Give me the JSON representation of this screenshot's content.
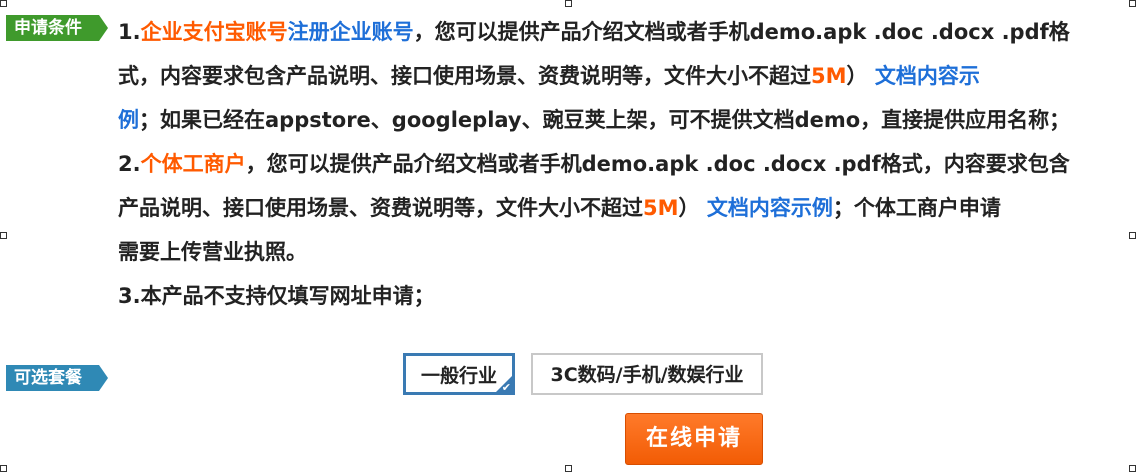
{
  "tags": {
    "conditions": "申请条件",
    "packages": "可选套餐"
  },
  "conditions": {
    "p1_num": "1.",
    "p1_enterprise_alipay": "企业支付宝账号",
    "p1_register": "注册企业账号",
    "p1_line1_rest": "，您可以提供产品介绍文档或者手机demo.apk .doc .docx .pdf格",
    "p1_line2_a": "式，内容要求包含产品说明、接口使用场景、资费说明等，文件大小不超过",
    "p1_line2_size": "5M",
    "p1_line2_b": "） ",
    "p1_line2_link": "文档内容示",
    "p1_line3_link": "例",
    "p1_line3_rest": "；如果已经在appstore、googleplay、豌豆荚上架，可不提供文档demo，直接提供应用名称；",
    "p2_num": "2.",
    "p2_individual": "个体工商户",
    "p2_line1_rest": "，您可以提供产品介绍文档或者手机demo.apk .doc .docx .pdf格式，内容要求包含",
    "p2_line2_a": "产品说明、接口使用场景、资费说明等，文件大小不超过",
    "p2_line2_size": "5M",
    "p2_line2_b": "） ",
    "p2_line2_link": "文档内容示例",
    "p2_line2_c": "；个体工商户申请",
    "p2_line3": "需要上传营业执照。",
    "p3": "3.本产品不支持仅填写网址申请；"
  },
  "packages": {
    "option1": "一般行业",
    "option1_selected": true,
    "option2": "3C数码/手机/数娱行业"
  },
  "apply_button": "在线申请",
  "colors": {
    "orange": "#ff5a00",
    "link_blue": "#1e6fd8",
    "tag_green": "#3f9a2c",
    "tag_blue": "#2f89b5",
    "selected_border": "#3a7ab3"
  }
}
